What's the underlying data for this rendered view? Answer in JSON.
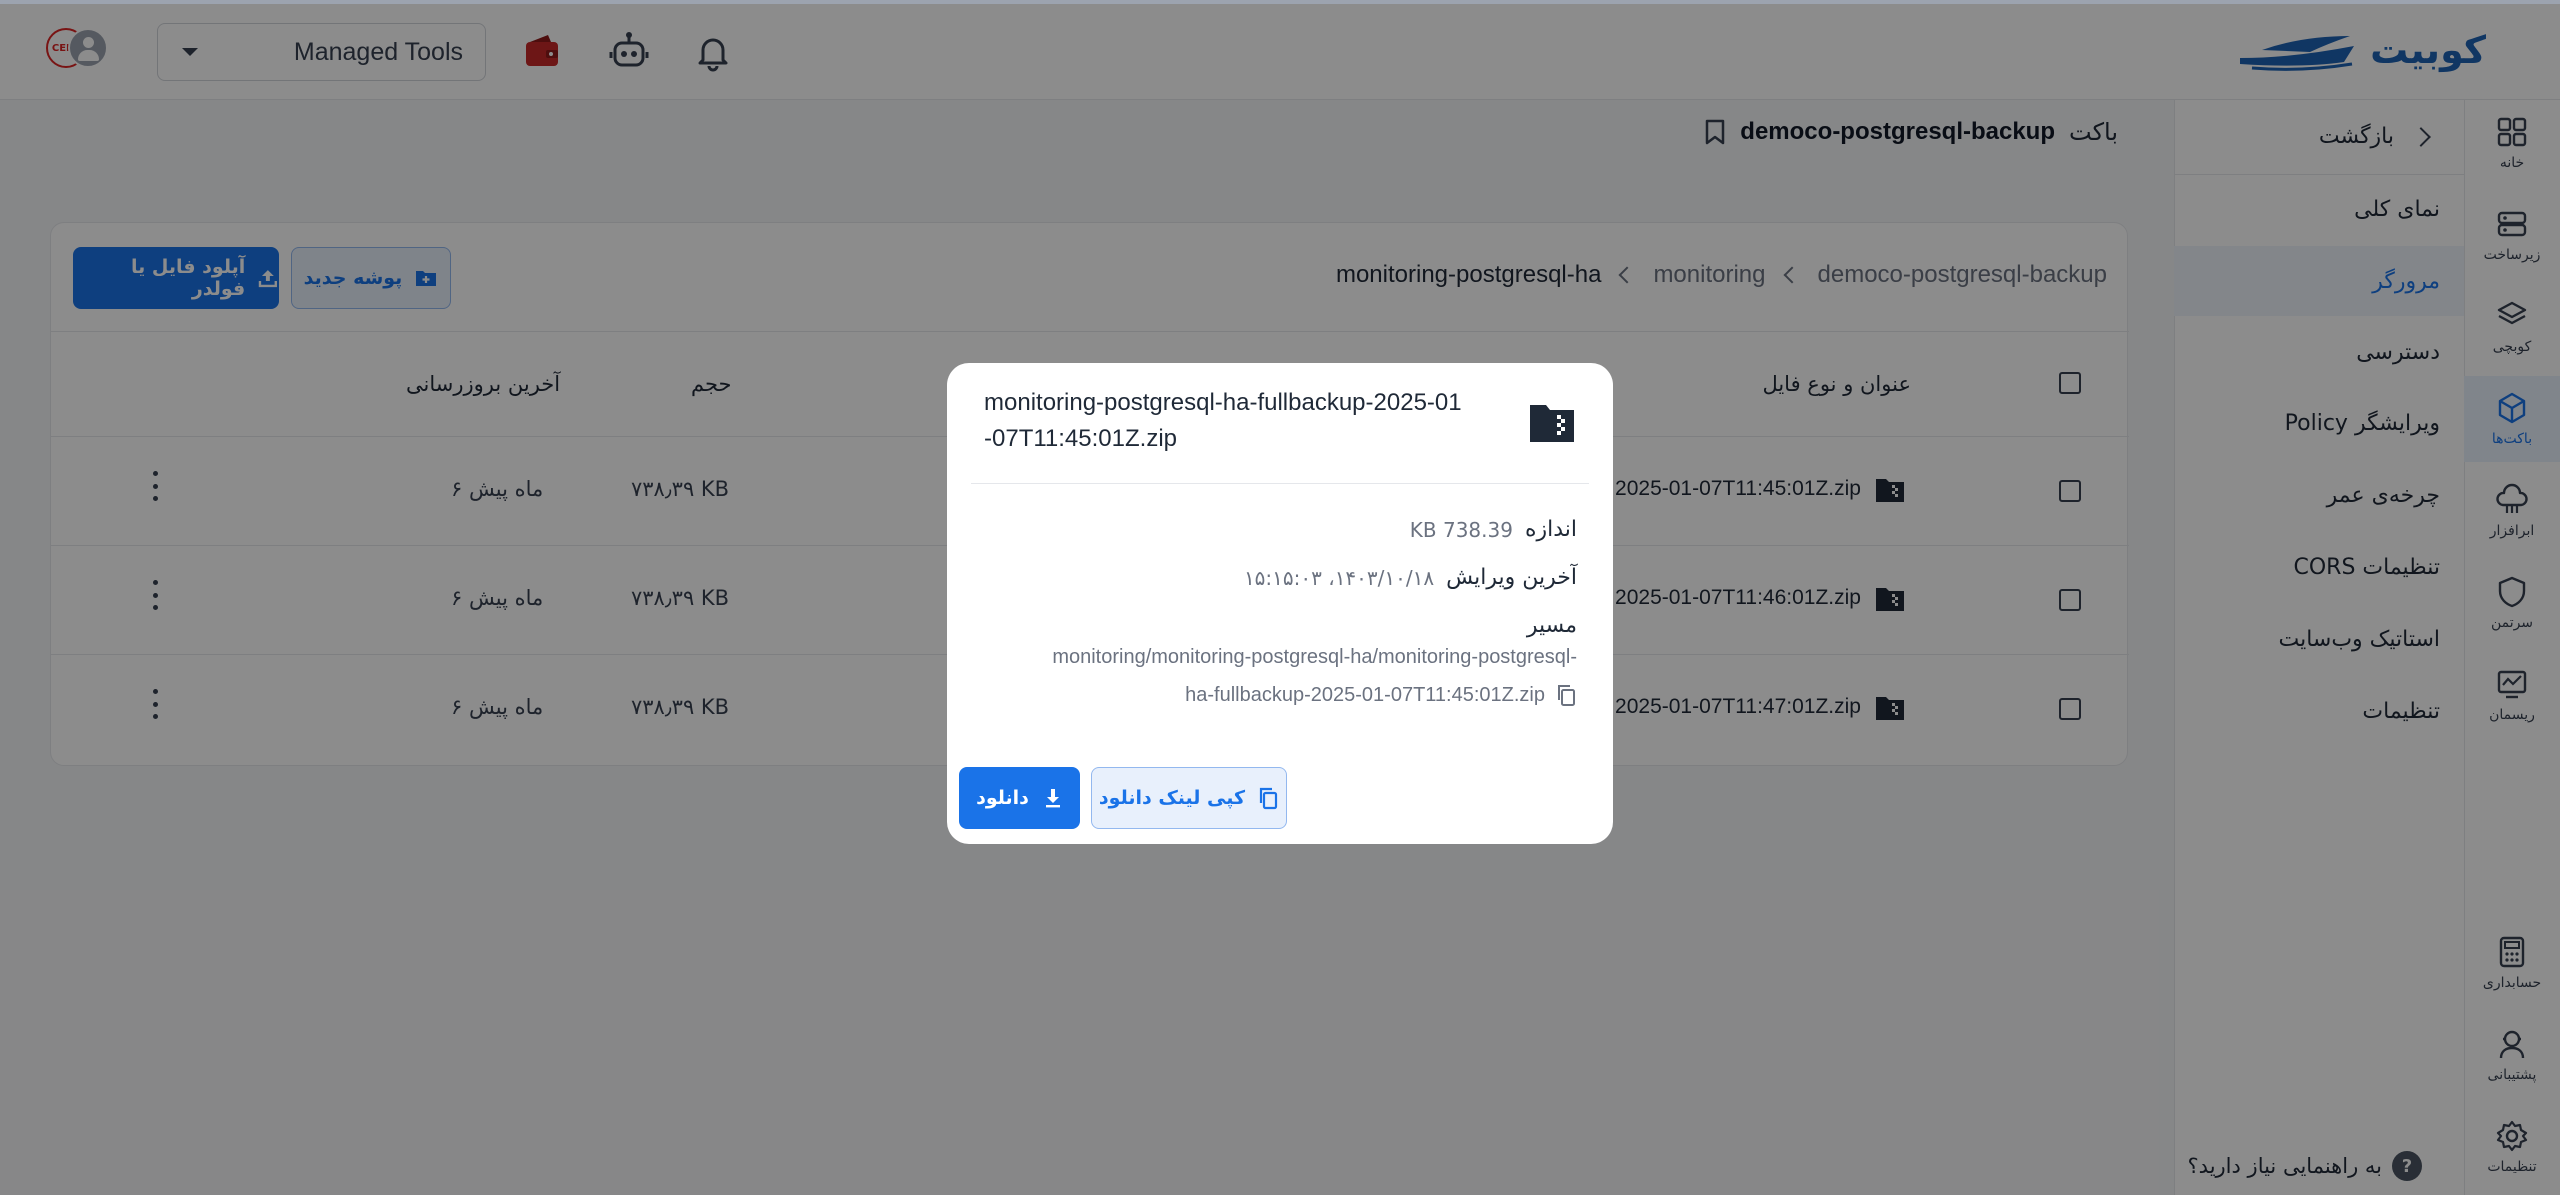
{
  "header": {
    "logo_text": "کوبیت",
    "avatar_badge": "CERT",
    "tools_select": {
      "selected": "Managed Tools"
    },
    "icons": [
      "wallet-icon",
      "robot-icon",
      "bell-icon"
    ]
  },
  "sidebar": {
    "items": [
      {
        "label": "خانه",
        "icon": "home-icon"
      },
      {
        "label": "زیرساخت",
        "icon": "server-icon"
      },
      {
        "label": "کوبچی",
        "icon": "layers-icon"
      },
      {
        "label": "باکت‌ها",
        "icon": "cube-icon",
        "active": true
      },
      {
        "label": "ابرافزار",
        "icon": "cloud-icon"
      },
      {
        "label": "سرتمن",
        "icon": "shield-icon"
      },
      {
        "label": "ریسمان",
        "icon": "monitor-icon"
      },
      {
        "label": "حسابداری",
        "icon": "calculator-icon"
      },
      {
        "label": "پشتیبانی",
        "icon": "support-icon"
      },
      {
        "label": "تنظیمات",
        "icon": "gear-icon"
      }
    ]
  },
  "subnav": {
    "back_label": "بازگشت",
    "items": [
      {
        "label": "نمای کلی"
      },
      {
        "label": "مرورگر",
        "active": true
      },
      {
        "label": "دسترسی"
      },
      {
        "label": "ویرایشگر Policy"
      },
      {
        "label": "چرخه‌ی عمر"
      },
      {
        "label": "تنظیمات CORS"
      },
      {
        "label": "استاتیک وب‌سایت"
      },
      {
        "label": "تنظیمات"
      }
    ],
    "help_label": "به راهنمایی نیاز دارید؟",
    "help_mark": "?"
  },
  "page": {
    "bucket_kind": "باکت",
    "bucket_name": "democo-postgresql-backup"
  },
  "browser": {
    "breadcrumb": [
      "democo-postgresql-backup",
      "monitoring",
      "monitoring-postgresql-ha"
    ],
    "new_folder_label": "پوشه جدید",
    "upload_label": "آپلود فایل یا فولدر",
    "columns": {
      "name": "عنوان و نوع فایل",
      "size": "حجم",
      "updated": "آخرین بروزرسانی"
    },
    "rows": [
      {
        "name": "2025-01-07T11:45:01Z.zip",
        "size": "۷۳۸٫۳۹ KB",
        "updated": "۶ ماه پیش"
      },
      {
        "name": "2025-01-07T11:46:01Z.zip",
        "size": "۷۳۸٫۳۹ KB",
        "updated": "۶ ماه پیش"
      },
      {
        "name": "2025-01-07T11:47:01Z.zip",
        "size": "۷۳۸٫۳۹ KB",
        "updated": "۶ ماه پیش"
      }
    ]
  },
  "modal": {
    "title": "monitoring-postgresql-ha-fullbackup-2025-01-07T11:45:01Z.zip",
    "size_label": "اندازه",
    "size_value": "738.39 KB",
    "modified_label": "آخرین ویرایش",
    "modified_value": "۱۴۰۳/۱۰/۱۸، ۱۵:۱۵:۰۳",
    "path_label": "مسیر",
    "path_line1": "monitoring/monitoring-postgresql-ha/monitoring-postgresql-",
    "path_line2": "ha-fullbackup-2025-01-07T11:45:01Z.zip",
    "copy_link_label": "کپی لینک دانلود",
    "download_label": "دانلود"
  },
  "colors": {
    "accent": "#1a73e8",
    "brand": "#1e63b5",
    "overlay": "rgba(0,0,0,0.45)"
  }
}
